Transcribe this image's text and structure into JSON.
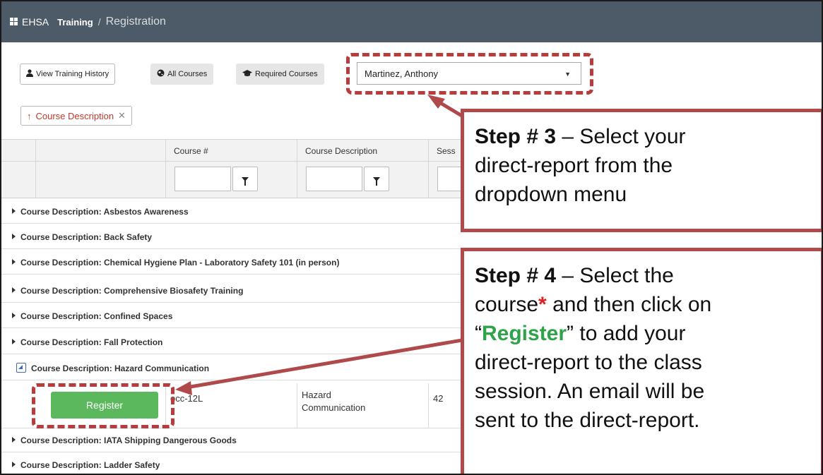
{
  "nav": {
    "brand": "EHSA",
    "crumb_link": "Training",
    "crumb_sep": "/",
    "crumb_current": "Registration"
  },
  "toolbar": {
    "view_history_label": "View Training History",
    "all_courses_label": "All Courses",
    "required_courses_label": "Required Courses",
    "user_select_value": "Martinez, Anthony"
  },
  "grouping": {
    "chip_arrow": "↑",
    "chip_label": "Course Description",
    "chip_close": "✕"
  },
  "grid": {
    "columns": [
      "Course #",
      "Course Description",
      "Sess"
    ],
    "groups": [
      "Course Description: Asbestos Awareness",
      "Course Description: Back Safety",
      "Course Description: Chemical Hygiene Plan - Laboratory Safety 101 (in person)",
      "Course Description: Comprehensive Biosafety Training",
      "Course Description: Confined Spaces",
      "Course Description: Fall Protection",
      "Course Description: Hazard Communication",
      "Course Description: IATA Shipping Dangerous Goods",
      "Course Description: Ladder Safety"
    ],
    "detail": {
      "register_label": "Register",
      "course_number": "occ-12L",
      "description_line1": "Hazard",
      "description_line2": "Communication",
      "session": "42"
    }
  },
  "callout_step3": {
    "step": "Step # 3",
    "dash": " – ",
    "line1_rest": "Select your",
    "line2": "direct-report from the",
    "line3": "dropdown menu"
  },
  "callout_step4": {
    "step": "Step # 4",
    "dash": " – ",
    "line1_rest": "Select the",
    "line2_a": "course",
    "star": "*",
    "line2_b": " and then click on",
    "quote_open": "“",
    "register_word": "Register",
    "quote_close_rest": "” to add your",
    "line4": "direct-report to the class",
    "line5": "session.  An email will be",
    "line6": "sent to the direct-report."
  },
  "colors": {
    "nav_bg": "#4d5a67",
    "callout_border": "#b04a4a",
    "dash_red": "#b83c3c",
    "register_green": "#5cb85c",
    "star_red": "#e02020",
    "register_word_green": "#2fa34a"
  },
  "icons": [
    "apps-icon",
    "user-icon",
    "globe-icon",
    "graduation-cap-icon",
    "caret-down-icon",
    "sort-up-icon",
    "close-icon",
    "filter-icon",
    "expand-triangle-icon",
    "collapse-icon",
    "arrow-icon"
  ]
}
